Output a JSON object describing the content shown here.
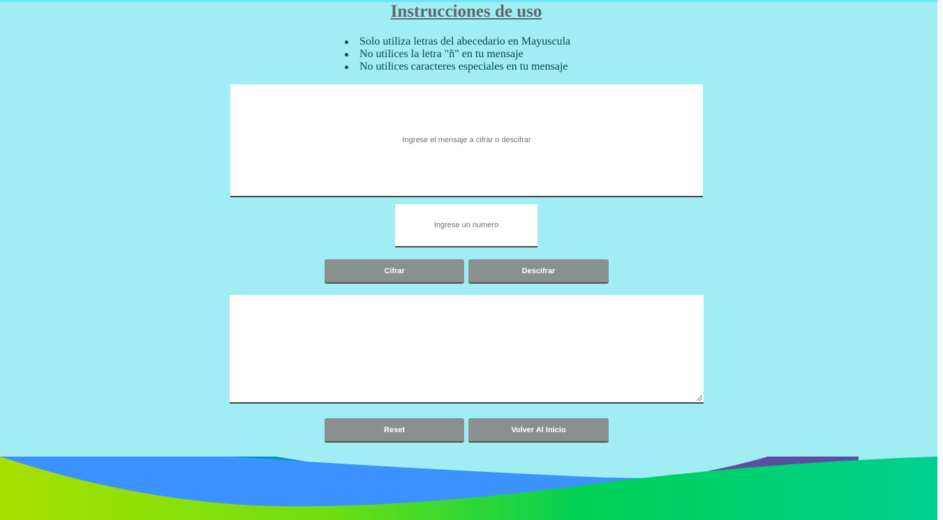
{
  "heading": {
    "title": "Instrucciones de uso"
  },
  "instructions": [
    "Solo utiliza letras del abecedario en Mayuscula",
    "No utilices la letra \"ñ\" en tu mensaje",
    "No utilices caracteres especiales en tu mensaje"
  ],
  "form": {
    "message_placeholder": "Ingrese el mensaje a cifrar o descifrar",
    "number_placeholder": "Ingrese un numero",
    "result_value": ""
  },
  "buttons": {
    "encrypt_label": "Cifrar",
    "decrypt_label": "Descifrar",
    "reset_label": "Reset",
    "home_label": "Volver Al Inicio"
  },
  "colors": {
    "background": "#a0edf4",
    "button": "#8a8f8f",
    "title": "#5f6869",
    "list_text": "#084b4f",
    "wave_green": "#00d154",
    "wave_blue": "#3c93ff",
    "wave_purple": "#5a4fa0",
    "wave_teal": "#0097b8"
  }
}
